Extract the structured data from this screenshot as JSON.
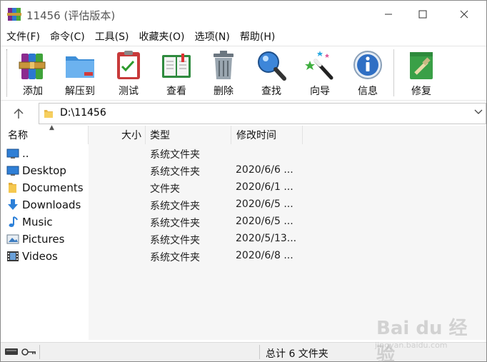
{
  "window": {
    "title": "11456 (评估版本)"
  },
  "menu": [
    {
      "label": "文件(F)"
    },
    {
      "label": "命令(C)"
    },
    {
      "label": "工具(S)"
    },
    {
      "label": "收藏夹(O)"
    },
    {
      "label": "选项(N)"
    },
    {
      "label": "帮助(H)"
    }
  ],
  "toolbar": {
    "add": "添加",
    "extract": "解压到",
    "test": "测试",
    "view": "查看",
    "delete": "删除",
    "find": "查找",
    "wizard": "向导",
    "info": "信息",
    "repair": "修复"
  },
  "address": {
    "path": "D:\\11456"
  },
  "columns": {
    "name": "名称",
    "size": "大小",
    "type": "类型",
    "modified": "修改时间"
  },
  "files": [
    {
      "name": "..",
      "icon": "monitor-icon",
      "type": "系统文件夹",
      "modified": ""
    },
    {
      "name": "Desktop",
      "icon": "desktop-icon",
      "type": "系统文件夹",
      "modified": "2020/6/6 ..."
    },
    {
      "name": "Documents",
      "icon": "folder-icon",
      "type": "文件夹",
      "modified": "2020/6/1 ..."
    },
    {
      "name": "Downloads",
      "icon": "download-icon",
      "type": "系统文件夹",
      "modified": "2020/6/5 ..."
    },
    {
      "name": "Music",
      "icon": "music-note-icon",
      "type": "系统文件夹",
      "modified": "2020/6/5 ..."
    },
    {
      "name": "Pictures",
      "icon": "picture-icon",
      "type": "系统文件夹",
      "modified": "2020/5/13..."
    },
    {
      "name": "Videos",
      "icon": "film-icon",
      "type": "系统文件夹",
      "modified": "2020/6/8 ..."
    }
  ],
  "status": {
    "summary": "总计 6 文件夹"
  },
  "watermark": {
    "brand": "Bai du 经验",
    "url": "jingyan.baidu.com"
  }
}
